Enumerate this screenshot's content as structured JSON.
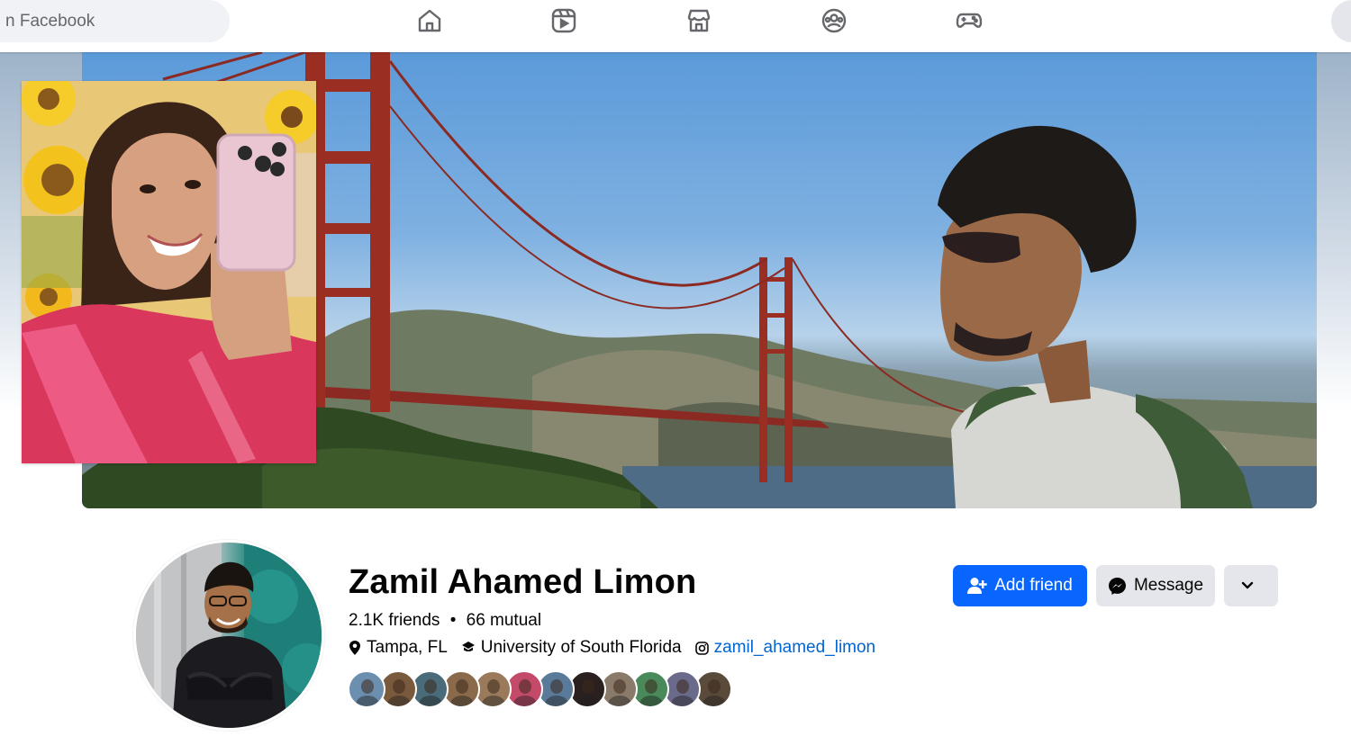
{
  "search": {
    "placeholder": "n Facebook"
  },
  "nav": {
    "icons": [
      "home-icon",
      "reels-icon",
      "marketplace-icon",
      "groups-icon",
      "gaming-icon"
    ]
  },
  "profile": {
    "name": "Zamil Ahamed Limon",
    "friends_count": "2.1K friends",
    "separator": "•",
    "mutual_count": "66 mutual",
    "location": "Tampa, FL",
    "school": "University of South Florida",
    "instagram": "zamil_ahamed_limon"
  },
  "actions": {
    "add_friend": "Add friend",
    "message": "Message"
  },
  "colors": {
    "primary_blue": "#0866ff",
    "link_blue": "#0064d1",
    "button_grey": "#e4e6eb",
    "search_bg": "#f0f2f5"
  },
  "mutual_friend_faces": [
    {
      "color": "#6c8fb0"
    },
    {
      "color": "#7a5a3c"
    },
    {
      "color": "#4a6c7a"
    },
    {
      "color": "#8a6a4a"
    },
    {
      "color": "#9a7a5a"
    },
    {
      "color": "#c44a6a"
    },
    {
      "color": "#5a7a9a"
    },
    {
      "color": "#2a2020"
    },
    {
      "color": "#8a7a6a"
    },
    {
      "color": "#4a8a5a"
    },
    {
      "color": "#6a6a8a"
    },
    {
      "color": "#5a4a3a"
    }
  ]
}
